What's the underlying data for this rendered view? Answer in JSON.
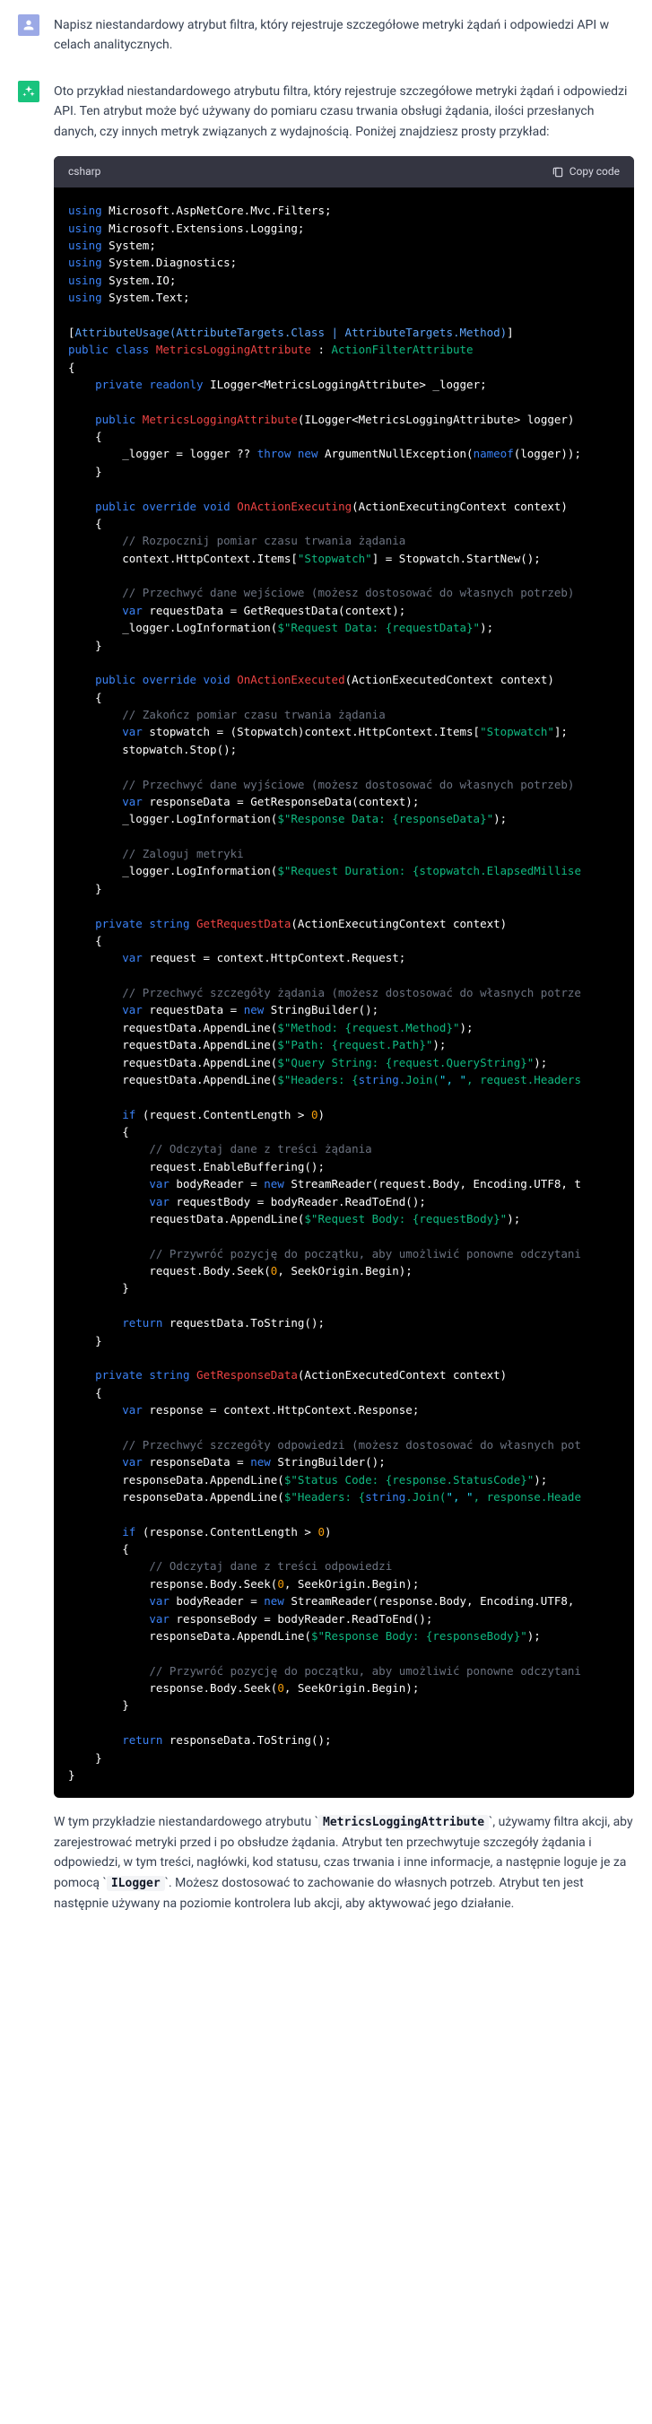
{
  "user": {
    "text": "Napisz niestandardowy atrybut filtra, który rejestruje szczegółowe metryki żądań i odpowiedzi API w celach analitycznych."
  },
  "assistant": {
    "intro": "Oto przykład niestandardowego atrybutu filtra, który rejestruje szczegółowe metryki żądań i odpowiedzi API. Ten atrybut może być używany do pomiaru czasu trwania obsługi żądania, ilości przesłanych danych, czy innych metryk związanych z wydajnością. Poniżej znajdziesz prosty przykład:",
    "lang": "csharp",
    "copy_label": "Copy code",
    "outro_1": "W tym przykładzie niestandardowego atrybutu ",
    "code_ref_1": "MetricsLoggingAttribute",
    "outro_2": ", używamy filtra akcji, aby zarejestrować metryki przed i po obsłudze żądania. Atrybut ten przechwytuje szczegóły żądania i odpowiedzi, w tym treści, nagłówki, kod statusu, czas trwania i inne informacje, a następnie loguje je za pomocą ",
    "code_ref_2": "ILogger",
    "outro_3": ". Możesz dostosować to zachowanie do własnych potrzeb. Atrybut ten jest następnie używany na poziomie kontrolera lub akcji, aby aktywować jego działanie."
  },
  "code": {
    "using_1": "Microsoft.AspNetCore.Mvc.Filters",
    "using_2": "Microsoft.Extensions.Logging",
    "using_3": "System",
    "using_4": "System.Diagnostics",
    "using_5": "System.IO",
    "using_6": "System.Text",
    "attr_usage": "AttributeUsage(AttributeTargets.Class | AttributeTargets.Method)",
    "class_name": "MetricsLoggingAttribute",
    "base_class": "ActionFilterAttribute",
    "field_logger": "ILogger<MetricsLoggingAttribute> _logger;",
    "ctor_param": "(ILogger<MetricsLoggingAttribute> logger)",
    "ctor_body_1": "_logger = logger ?? ",
    "ctor_throw": "throw new",
    "ctor_exc": " ArgumentNullException(",
    "ctor_nameof": "nameof",
    "ctor_nameof_arg": "(logger));",
    "exec_param": "(ActionExecutingContext context)",
    "executed_param": "(ActionExecutedContext context)",
    "comment_start": "// Rozpocznij pomiar czasu trwania żądania",
    "stopwatch_set": "context.HttpContext.Items[",
    "stopwatch_key": "\"Stopwatch\"",
    "stopwatch_new": "] = Stopwatch.StartNew();",
    "comment_req_in": "// Przechwyć dane wejściowe (możesz dostosować do własnych potrzeb)",
    "req_var": "requestData = GetRequestData(context);",
    "log_req": "_logger.LogInformation(",
    "log_req_str": "$\"Request Data: {requestData}\"",
    "comment_stop_end": "// Zakończ pomiar czasu trwania żądania",
    "stop_get": "stopwatch = (Stopwatch)context.HttpContext.Items[",
    "stop_stop": "stopwatch.Stop();",
    "comment_resp_out": "// Przechwyć dane wyjściowe (możesz dostosować do własnych potrzeb)",
    "resp_var": "responseData = GetResponseData(context);",
    "log_resp_str": "$\"Response Data: {responseData}\"",
    "comment_log_metrics": "// Zaloguj metryki",
    "log_duration_str": "$\"Request Duration: {stopwatch.ElapsedMillise",
    "getreq_param": "(ActionExecutingContext context)",
    "req_get": "request = context.HttpContext.Request;",
    "comment_req_details": "// Przechwyć szczegóły żądania (możesz dostosować do własnych potrze",
    "sb_new": "StringBuilder();",
    "append_method": "$\"Method: {request.Method}\"",
    "append_path": "$\"Path: {request.Path}\"",
    "append_query": "$\"Query String: {request.QueryString}\"",
    "append_headers_1": "$\"Headers: {",
    "string_join": "string",
    "append_headers_2": ".Join(",
    "join_sep": "\", \"",
    "append_headers_3": ", request.Headers",
    "if_contentlen": "(request.ContentLength > ",
    "zero": "0",
    "comment_read_body": "// Odczytaj dane z treści żądania",
    "enable_buffering": "request.EnableBuffering();",
    "streamreader_new": "StreamReader(request.Body, Encoding.UTF8, t",
    "read_to_end": "bodyReader.ReadToEnd();",
    "append_body": "$\"Request Body: {requestBody}\"",
    "comment_seek": "// Przywróć pozycję do początku, aby umożliwić ponowne odczytani",
    "seek_call": "request.Body.Seek(",
    "seek_origin": ", SeekOrigin.Begin);",
    "return_tostring": "requestData.ToString();",
    "getresp_param": "(ActionExecutedContext context)",
    "resp_get": "response = context.HttpContext.Response;",
    "comment_resp_details": "// Przechwyć szczegóły odpowiedzi (możesz dostosować do własnych pot",
    "append_status": "$\"Status Code: {response.StatusCode}\"",
    "append_resp_headers_3": ", response.Heade",
    "if_resp_contentlen": "(response.ContentLength > ",
    "comment_read_resp_body": "// Odczytaj dane z treści odpowiedzi",
    "resp_seek_1": "response.Body.Seek(",
    "streamreader_resp_new": "StreamReader(response.Body, Encoding.UTF8,",
    "append_resp_body": "$\"Response Body: {responseBody}\"",
    "comment_seek_resp": "// Przywróć pozycję do początku, aby umożliwić ponowne odczytani",
    "return_resp_tostring": "responseData.ToString();"
  }
}
